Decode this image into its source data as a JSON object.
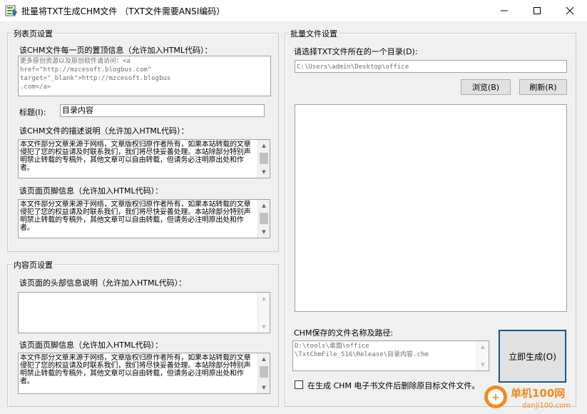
{
  "window": {
    "title": "批量将TXT生成CHM文件 （TXT文件需要ANSI编码）",
    "min_glyph": "—",
    "max_glyph": "☐",
    "close_glyph": "✕"
  },
  "list_settings": {
    "legend": "列表页设置",
    "top_info_label": "该CHM文件每一页的置顶信息（允许加入HTML代码）：",
    "top_info_value": "更多原创资源以及原创软件请访问：<a\nhref=\"http://mzcesoft.blogbus.com\"\ntarget=\"_blank\">http://mzcesoft.blogbus\n.com</a>",
    "title_label": "标题(I):",
    "title_value": "目录内容",
    "desc_label": "该CHM文件的描述说明（允许加入HTML代码）：",
    "desc_value": "本文件部分文章来源于网络，文章版权归原作者所有，如果本站转载的文章侵犯了您的权益请及时联系我们，我们将尽快妥善处理。本站除部分特别声明禁止转载的专稿外，其他文章可以自由转载，但请务必注明原出处和作者。",
    "footer_label": "该页面页脚信息（允许加入HTML代码）：",
    "footer_value": "本文件部分文章来源于网络，文章版权归原作者所有，如果本站转载的文章侵犯了您的权益请及时联系我们，我们将尽快妥善处理。本站除部分特别声明禁止转载的专稿外，其他文章可以自由转载，但请务必注明原出处和作者。"
  },
  "content_settings": {
    "legend": "内容页设置",
    "header_label": "该页面的头部信息说明（允许加入HTML代码）：",
    "header_value": "",
    "footer_label": "该页面页脚信息（允许加入HTML代码）：",
    "footer_value": "本文件部分文章来源于网络，文章版权归原作者所有，如果本站转载的文章侵犯了您的权益请及时联系我们，我们将尽快妥善处理。本站除部分特别声明禁止转载的专稿外，其他文章可以自由转载，但请务必注明原出处和作者。"
  },
  "batch_settings": {
    "legend": "批量文件设置",
    "dir_label": "请选择TXT文件所在的一个目录(D):",
    "dir_value": "C:\\Users\\admin\\Desktop\\office",
    "browse_label": "浏览(B)",
    "refresh_label": "刷新(R)",
    "output_label": "CHM保存的文件名称及路径:",
    "output_value": "D:\\tools\\桌面\\office\n\\TxtChmFile_516\\Release\\目录内容.chm",
    "generate_label": "立即生成(O)",
    "delete_checkbox_label": "在生成 CHM 电子书文件后删除原目标文件文件。",
    "delete_checked": false
  },
  "watermark": {
    "brand": "单机100网",
    "url": "danji100.com"
  }
}
